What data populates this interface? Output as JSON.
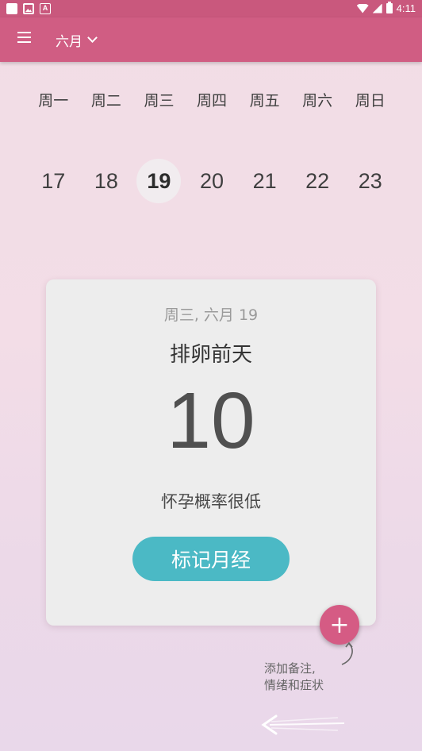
{
  "status_bar": {
    "time": "4:11",
    "icons": [
      "notification-square-icon",
      "image-icon",
      "font-a-icon",
      "wifi-icon",
      "signal-icon",
      "battery-icon"
    ]
  },
  "app_bar": {
    "menu_icon": "hamburger-menu-icon",
    "month_label": "六月",
    "dropdown_icon": "chevron-down-icon"
  },
  "week": {
    "weekdays": [
      "周一",
      "周二",
      "周三",
      "周四",
      "周五",
      "周六",
      "周日"
    ],
    "dates": [
      "17",
      "18",
      "19",
      "20",
      "21",
      "22",
      "23"
    ],
    "selected_date": "19"
  },
  "card": {
    "date_label": "周三, 六月 19",
    "title": "排卵前天",
    "count": "10",
    "status": "怀孕概率很低",
    "button_label": "标记月经"
  },
  "fab": {
    "icon": "plus-icon",
    "label": "+"
  },
  "hint": {
    "line1": "添加备注,",
    "line2": "情绪和症状"
  },
  "colors": {
    "app_bar": "#d05d83",
    "status_bar": "#c9587d",
    "accent_button": "#4bb9c5",
    "fab": "#d55b84",
    "card": "#ededed"
  }
}
